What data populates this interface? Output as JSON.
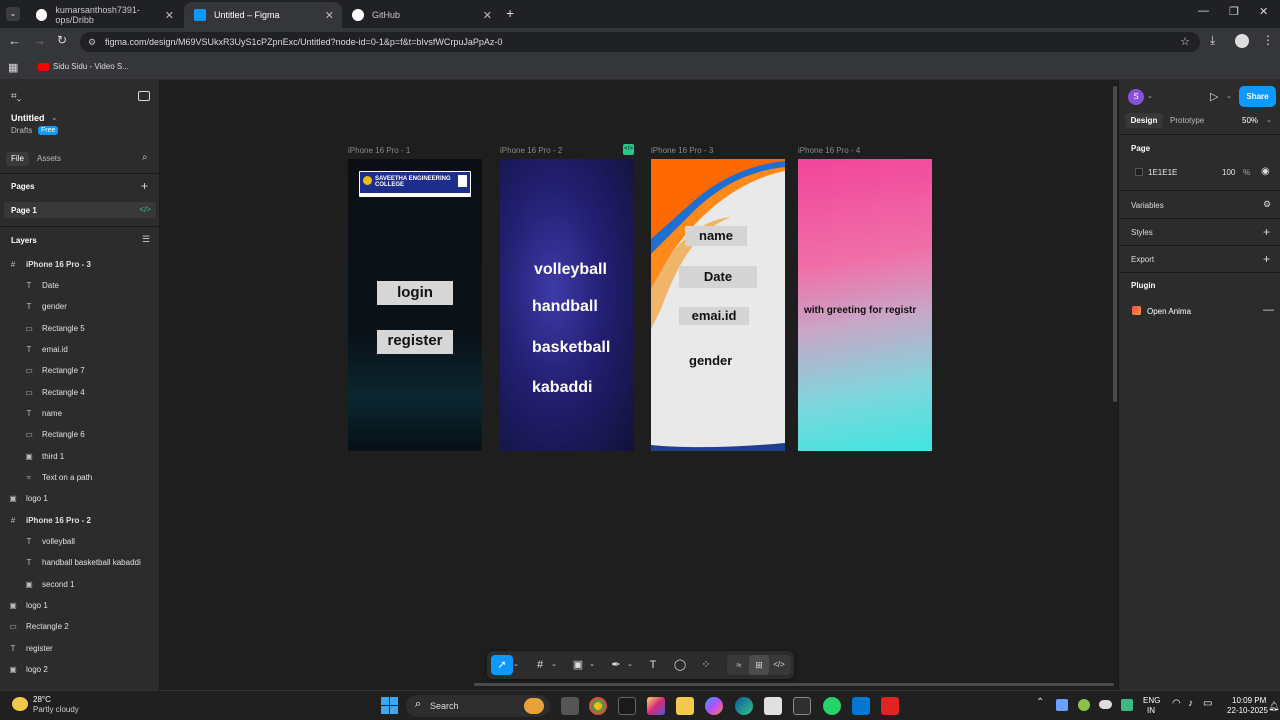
{
  "browser": {
    "tabs": [
      {
        "label": "kumarsanthosh7391-ops/Dribb"
      },
      {
        "label": "Untitled – Figma"
      },
      {
        "label": "GitHub"
      }
    ],
    "url": "figma.com/design/M69VSUkxR3UyS1cPZpnExc/Untitled?node-id=0-1&p=f&t=bIvsfWCrpuJaPpAz-0",
    "bookmark": "Sidu Sidu - Video S..."
  },
  "file": {
    "title": "Untitled",
    "drafts": "Drafts",
    "plan_badge": "Free",
    "tab_file": "File",
    "tab_assets": "Assets"
  },
  "pages": {
    "header": "Pages",
    "current": "Page 1"
  },
  "layers": {
    "header": "Layers",
    "items": [
      {
        "label": "iPhone 16 Pro - 3",
        "icon": "#"
      },
      {
        "label": "Date",
        "icon": "T"
      },
      {
        "label": "gender",
        "icon": "T"
      },
      {
        "label": "Rectangle 5",
        "icon": "▭"
      },
      {
        "label": "emai.id",
        "icon": "T"
      },
      {
        "label": "Rectangle 7",
        "icon": "▭"
      },
      {
        "label": "Rectangle 4",
        "icon": "▭"
      },
      {
        "label": "name",
        "icon": "T"
      },
      {
        "label": "Rectangle 6",
        "icon": "▭"
      },
      {
        "label": "third 1",
        "icon": "▣"
      },
      {
        "label": "Text on a path",
        "icon": "≈"
      },
      {
        "label": "logo 1",
        "icon": "▣"
      },
      {
        "label": "iPhone 16 Pro - 2",
        "icon": "#"
      },
      {
        "label": "volleyball",
        "icon": "T"
      },
      {
        "label": "handball basketball kabaddi",
        "icon": "T"
      },
      {
        "label": "second 1",
        "icon": "▣"
      },
      {
        "label": "logo 1",
        "icon": "▣"
      },
      {
        "label": "Rectangle 2",
        "icon": "▭"
      },
      {
        "label": "register",
        "icon": "T"
      },
      {
        "label": "logo 2",
        "icon": "▣"
      }
    ]
  },
  "frames": {
    "f1": {
      "label": "iPhone 16 Pro - 1",
      "login": "login",
      "register": "register",
      "logo_title": "SAVEETHA ENGINEERING COLLEGE"
    },
    "f2": {
      "label": "iPhone 16 Pro - 2",
      "items": [
        "volleyball",
        "handball",
        "basketball",
        "kabaddi"
      ]
    },
    "f3": {
      "label": "iPhone 16 Pro - 3",
      "fields": [
        "name",
        "Date",
        "emai.id",
        "gender"
      ]
    },
    "f4": {
      "label": "iPhone 16 Pro - 4",
      "greeting": "with greeting  for registr"
    }
  },
  "right_panel": {
    "avatar": "S",
    "share": "Share",
    "tab_design": "Design",
    "tab_prototype": "Prototype",
    "zoom": "50%",
    "page_header": "Page",
    "page_color": "1E1E1E",
    "page_opacity": "100",
    "percent": "%",
    "variables": "Variables",
    "styles": "Styles",
    "export": "Export",
    "plugin": "Plugin",
    "plugin_name": "Open Anima"
  },
  "taskbar": {
    "temp": "28°C",
    "weather": "Partly cloudy",
    "search": "Search",
    "lang1": "ENG",
    "lang2": "IN",
    "time": "10:09 PM",
    "date": "22-10-2025"
  },
  "colors": {
    "accent": "#0d99ff",
    "figma_bg": "#1e1e1e",
    "panel": "#2c2c2c"
  }
}
